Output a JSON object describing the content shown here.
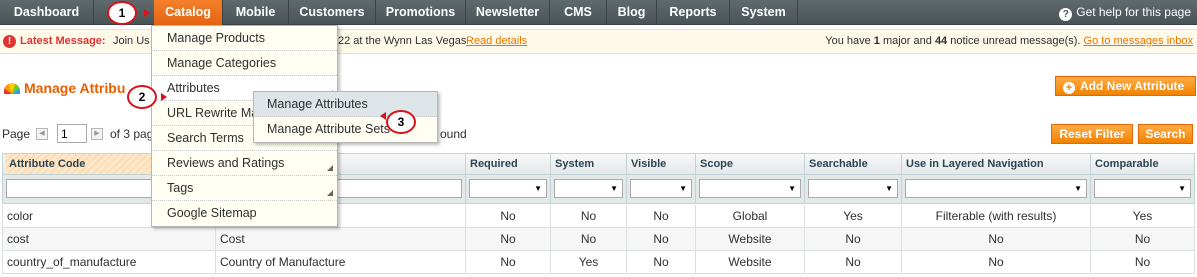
{
  "nav": {
    "items": [
      "Dashboard",
      "Catalog",
      "Mobile",
      "Customers",
      "Promotions",
      "Newsletter",
      "CMS",
      "Blog",
      "Reports",
      "System"
    ],
    "active": "Catalog",
    "help_label": "Get help for this page"
  },
  "message": {
    "label": "Latest Message:",
    "text_start": "Join Us",
    "text_end": "22 at the Wynn Las Vegas",
    "read_details": "Read details",
    "summary_prefix": "You have ",
    "major_count": "1",
    "summary_mid1": " major and ",
    "notice_count": "44",
    "summary_mid2": " notice unread message(s). ",
    "goto_link": "Go to messages inbox"
  },
  "page": {
    "title": "Manage Attribu",
    "add_button": "Add New Attribute"
  },
  "pager": {
    "page_label": "Page",
    "page_value": "1",
    "of_pages": "of 3 pag",
    "records_tail": "ound"
  },
  "buttons": {
    "reset_filter": "Reset Filter",
    "search": "Search"
  },
  "grid": {
    "columns": [
      "Attribute Code",
      "",
      "Required",
      "System",
      "Visible",
      "Scope",
      "Searchable",
      "Use in Layered Navigation",
      "Comparable"
    ],
    "rows": [
      [
        "color",
        "",
        "No",
        "No",
        "No",
        "Global",
        "Yes",
        "Filterable (with results)",
        "Yes"
      ],
      [
        "cost",
        "Cost",
        "No",
        "No",
        "No",
        "Website",
        "No",
        "No",
        "No"
      ],
      [
        "country_of_manufacture",
        "Country of Manufacture",
        "No",
        "Yes",
        "No",
        "Website",
        "No",
        "No",
        "No"
      ]
    ]
  },
  "catalog_menu": {
    "items": [
      "Manage Products",
      "Manage Categories",
      "Attributes",
      "URL Rewrite Ma",
      "Search Terms",
      "Reviews and Ratings",
      "Tags",
      "Google Sitemap"
    ]
  },
  "attributes_submenu": {
    "items": [
      "Manage Attributes",
      "Manage Attribute Sets"
    ]
  },
  "steps": [
    "1",
    "2",
    "3"
  ],
  "colors": {
    "accent": "#eb5e00",
    "nav_bg": "#4f5a5d",
    "callout": "#d8121a"
  }
}
